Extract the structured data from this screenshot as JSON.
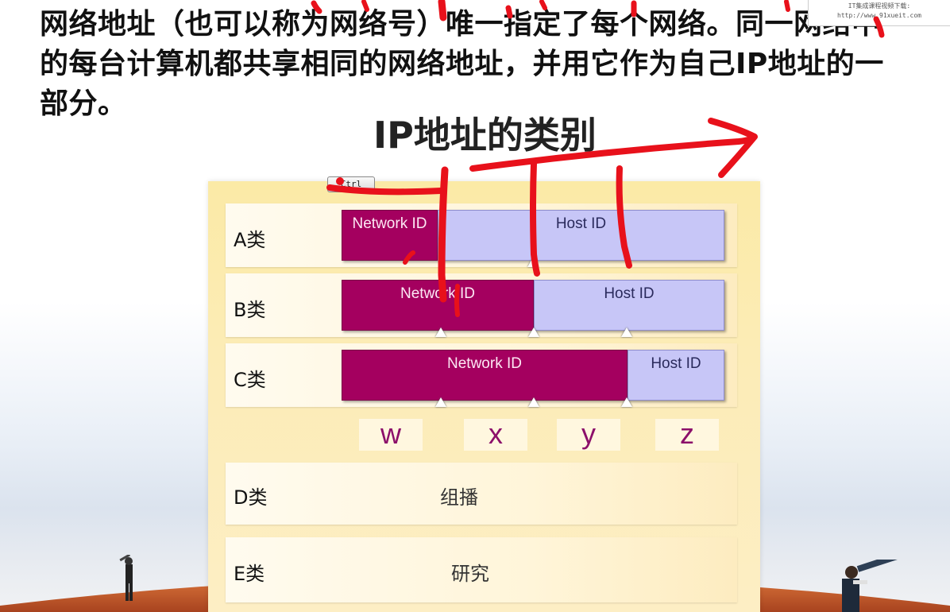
{
  "intro_text": "网络地址（也可以称为网络号）唯一指定了每个网络。同一网络中的每台计算机都共享相同的网络地址，并用它作为自己IP地址的一部分。",
  "watermark": {
    "line1": "IT集成课程视频下载:",
    "line2": "http://www.91xueit.com"
  },
  "title": "IP地址的类别",
  "ctrl_badge": "Ctrl",
  "classes": [
    {
      "label": "A类",
      "network": "Network ID",
      "host": "Host ID"
    },
    {
      "label": "B类",
      "network": "Network ID",
      "host": "Host ID"
    },
    {
      "label": "C类",
      "network": "Network ID",
      "host": "Host ID"
    },
    {
      "label": "D类",
      "text": "组播"
    },
    {
      "label": "E类",
      "text": "研究"
    }
  ],
  "octets": [
    "w",
    "x",
    "y",
    "z"
  ],
  "colors": {
    "network_segment": "#a4005f",
    "host_segment": "#c7c6f7",
    "octet_text": "#8c0f6a",
    "annotation_ink": "#e8111b"
  }
}
